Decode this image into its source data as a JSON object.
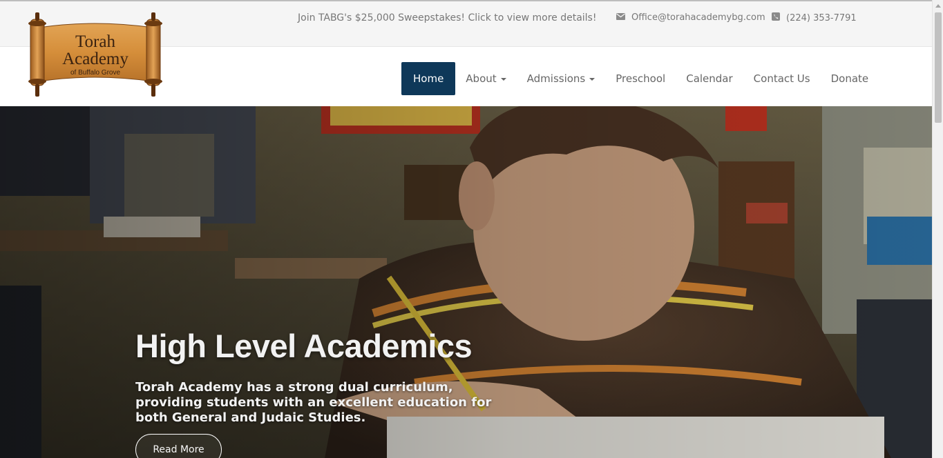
{
  "topbar": {
    "promo": "Join TABG's $25,000 Sweepstakes! Click to view more details!",
    "email": "Office@torahacademybg.com",
    "phone": "(224) 353-7791",
    "email_icon": "envelope-icon",
    "phone_icon": "phone-icon"
  },
  "logo": {
    "line1": "Torah",
    "line2": "Academy",
    "line3": "of Buffalo Grove"
  },
  "nav": {
    "items": [
      {
        "label": "Home",
        "active": true
      },
      {
        "label": "About",
        "dropdown": true
      },
      {
        "label": "Admissions",
        "dropdown": true
      },
      {
        "label": "Preschool"
      },
      {
        "label": "Calendar"
      },
      {
        "label": "Contact Us"
      },
      {
        "label": "Donate"
      }
    ],
    "active_color": "#0e3859"
  },
  "hero": {
    "title": "High Level Academics",
    "text": "Torah Academy has a strong dual curriculum, providing students with an excellent education for both General and Judaic Studies.",
    "button": "Read More"
  }
}
